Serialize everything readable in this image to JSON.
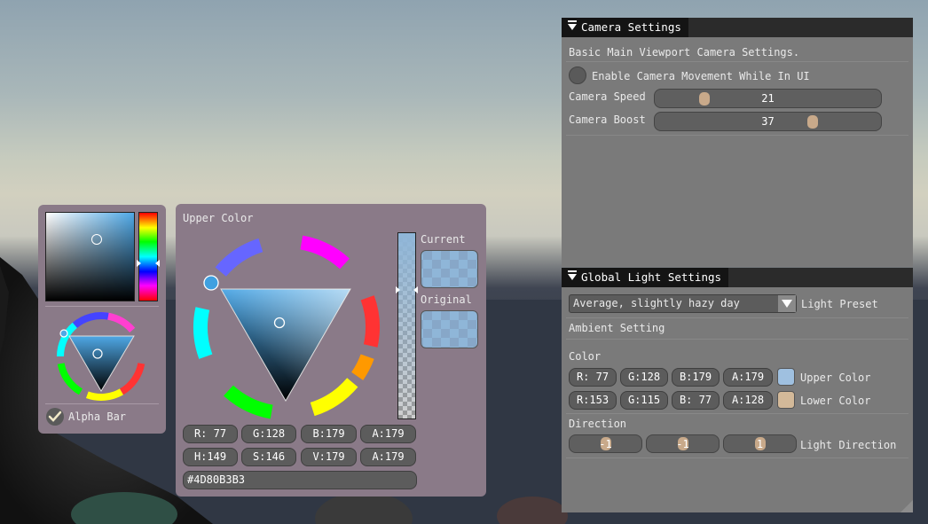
{
  "left_picker": {
    "alpha_bar_label": "Alpha Bar",
    "alpha_bar_checked": true
  },
  "color_picker": {
    "title": "Upper Color",
    "current_label": "Current",
    "original_label": "Original",
    "color_hex_value": "#4D80B3",
    "rgba_fields": [
      "R: 77",
      "G:128",
      "B:179",
      "A:179"
    ],
    "hsva_fields": [
      "H:149",
      "S:146",
      "V:179",
      "A:179"
    ],
    "hex_field": "#4D80B3B3"
  },
  "camera_settings": {
    "title": "Camera Settings",
    "description": "Basic Main Viewport Camera Settings.",
    "enable_movement_label": "Enable Camera Movement While In UI",
    "enable_movement_checked": false,
    "speed_label": "Camera Speed",
    "speed_value": "21",
    "boost_label": "Camera Boost",
    "boost_value": "37"
  },
  "global_light_settings": {
    "title": "Global Light Settings",
    "preset_value": "Average, slightly hazy day",
    "preset_label": "Light Preset",
    "ambient_heading": "Ambient Setting",
    "color_heading": "Color",
    "upper": {
      "fields": [
        "R: 77",
        "G:128",
        "B:179",
        "A:179"
      ],
      "label": "Upper Color",
      "swatch_color": "#9fc0e0"
    },
    "lower": {
      "fields": [
        "R:153",
        "G:115",
        "B: 77",
        "A:128"
      ],
      "label": "Lower Color",
      "swatch_color": "#d3b999"
    },
    "direction_heading": "Direction",
    "direction_values": [
      "-1",
      "-1",
      "1"
    ],
    "direction_label": "Light Direction"
  },
  "colors": {
    "panel_bg": "#8a7a88",
    "window_bg": "#7a7a7a",
    "accent": "#4d80b3",
    "grab": "#c8a98a"
  }
}
